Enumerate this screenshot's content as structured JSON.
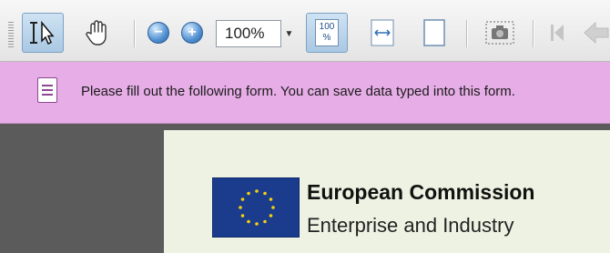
{
  "toolbar": {
    "tools": [
      {
        "name": "select-tool",
        "icon": "text-select-cursor-icon",
        "active": true
      },
      {
        "name": "hand-tool",
        "icon": "hand-icon",
        "active": false
      }
    ],
    "zoom_out_icon": "minus-circle-icon",
    "zoom_in_icon": "plus-circle-icon",
    "zoom_value": "100%",
    "zoom_dropdown_icon": "chevron-down-icon",
    "actual_size_icon": "actual-size-100-icon",
    "fit_width_icon": "fit-width-icon",
    "fit_page_icon": "fit-page-icon",
    "snapshot_icon": "camera-icon",
    "first_page_icon": "first-page-icon",
    "prev_page_icon": "previous-page-icon",
    "actual_size_label_top": "100",
    "actual_size_label_bottom": "%"
  },
  "form_bar": {
    "icon": "form-document-icon",
    "message": "Please fill out the following form. You can save data typed into this form.",
    "color": "#e6ade6"
  },
  "document": {
    "logo": "eu-flag-logo",
    "org_name": "European Commission",
    "org_dept": "Enterprise and Industry"
  }
}
